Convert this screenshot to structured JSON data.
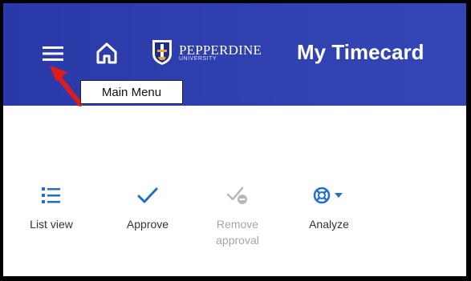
{
  "header": {
    "title": "My Timecard",
    "logo": {
      "name": "PEPPERDINE",
      "sub": "UNIVERSITY"
    },
    "menu_icon": "hamburger-menu-icon",
    "home_icon": "home-icon"
  },
  "tooltip": {
    "text": "Main Menu"
  },
  "toolbar": {
    "items": [
      {
        "label": "List view",
        "icon": "list-view-icon",
        "enabled": true
      },
      {
        "label": "Approve",
        "icon": "checkmark-icon",
        "enabled": true
      },
      {
        "label": "Remove approval",
        "icon": "remove-approval-icon",
        "enabled": false
      },
      {
        "label": "Analyze",
        "icon": "analyze-icon",
        "enabled": true
      }
    ]
  },
  "colors": {
    "header_bg": "#2a39a8",
    "accent": "#1f6fd1",
    "disabled": "#a6a6a6",
    "annotation_arrow": "#e01b1b"
  }
}
